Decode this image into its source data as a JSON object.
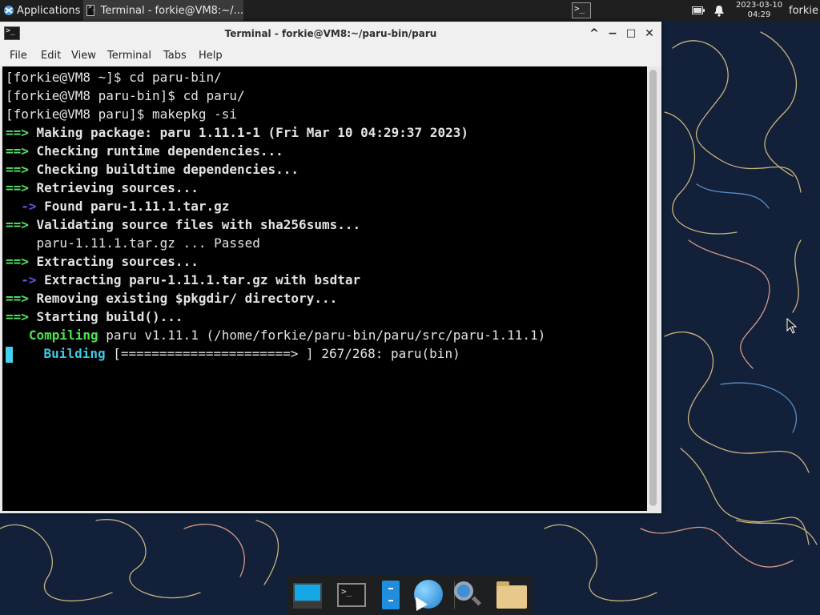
{
  "top_panel": {
    "applications_label": "Applications",
    "task_title": "Terminal - forkie@VM8:~/...",
    "date": "2023-03-10",
    "time": "04:29",
    "user": "forkie"
  },
  "window": {
    "title": "Terminal - forkie@VM8:~/paru-bin/paru",
    "controls": {
      "shade": "^",
      "minimize": "−",
      "maximize": "□",
      "close": "✕"
    }
  },
  "menu": [
    "File",
    "Edit",
    "View",
    "Terminal",
    "Tabs",
    "Help"
  ],
  "terminal": {
    "lines": [
      {
        "prompt": "[forkie@VM8 ~]$ ",
        "cmd": "cd paru-bin/"
      },
      {
        "prompt": "[forkie@VM8 paru-bin]$ ",
        "cmd": "cd paru/"
      },
      {
        "prompt": "[forkie@VM8 paru]$ ",
        "cmd": "makepkg -si"
      },
      {
        "arrow": "==>",
        "text": " Making package: paru 1.11.1-1 (Fri Mar 10 04:29:37 2023)"
      },
      {
        "arrow": "==>",
        "text": " Checking runtime dependencies..."
      },
      {
        "arrow": "==>",
        "text": " Checking buildtime dependencies..."
      },
      {
        "arrow": "==>",
        "text": " Retrieving sources..."
      },
      {
        "subarrow": "  ->",
        "text": " Found paru-1.11.1.tar.gz"
      },
      {
        "arrow": "==>",
        "text": " Validating source files with sha256sums..."
      },
      {
        "plain": "    paru-1.11.1.tar.gz ... Passed"
      },
      {
        "arrow": "==>",
        "text": " Extracting sources..."
      },
      {
        "subarrow": "  ->",
        "text": " Extracting paru-1.11.1.tar.gz with bsdtar"
      },
      {
        "arrow": "==>",
        "text": " Removing existing $pkgdir/ directory..."
      },
      {
        "arrow": "==>",
        "text": " Starting build()..."
      },
      {
        "compile_label": "   Compiling",
        "compile_text": " paru v1.11.1 (/home/forkie/paru-bin/paru/src/paru-1.11.1)"
      },
      {
        "build_label": "Building",
        "build_text": " [======================> ] 267/268: paru(bin)"
      }
    ]
  },
  "dock": {
    "items": [
      "show-desktop",
      "terminal",
      "file-manager",
      "web-browser",
      "app-finder",
      "home-folder"
    ]
  },
  "colors": {
    "arrow_green": "#59e069",
    "arrow_blue": "#5858e8",
    "compiling": "#4ee24e",
    "building": "#3ec9e6"
  }
}
